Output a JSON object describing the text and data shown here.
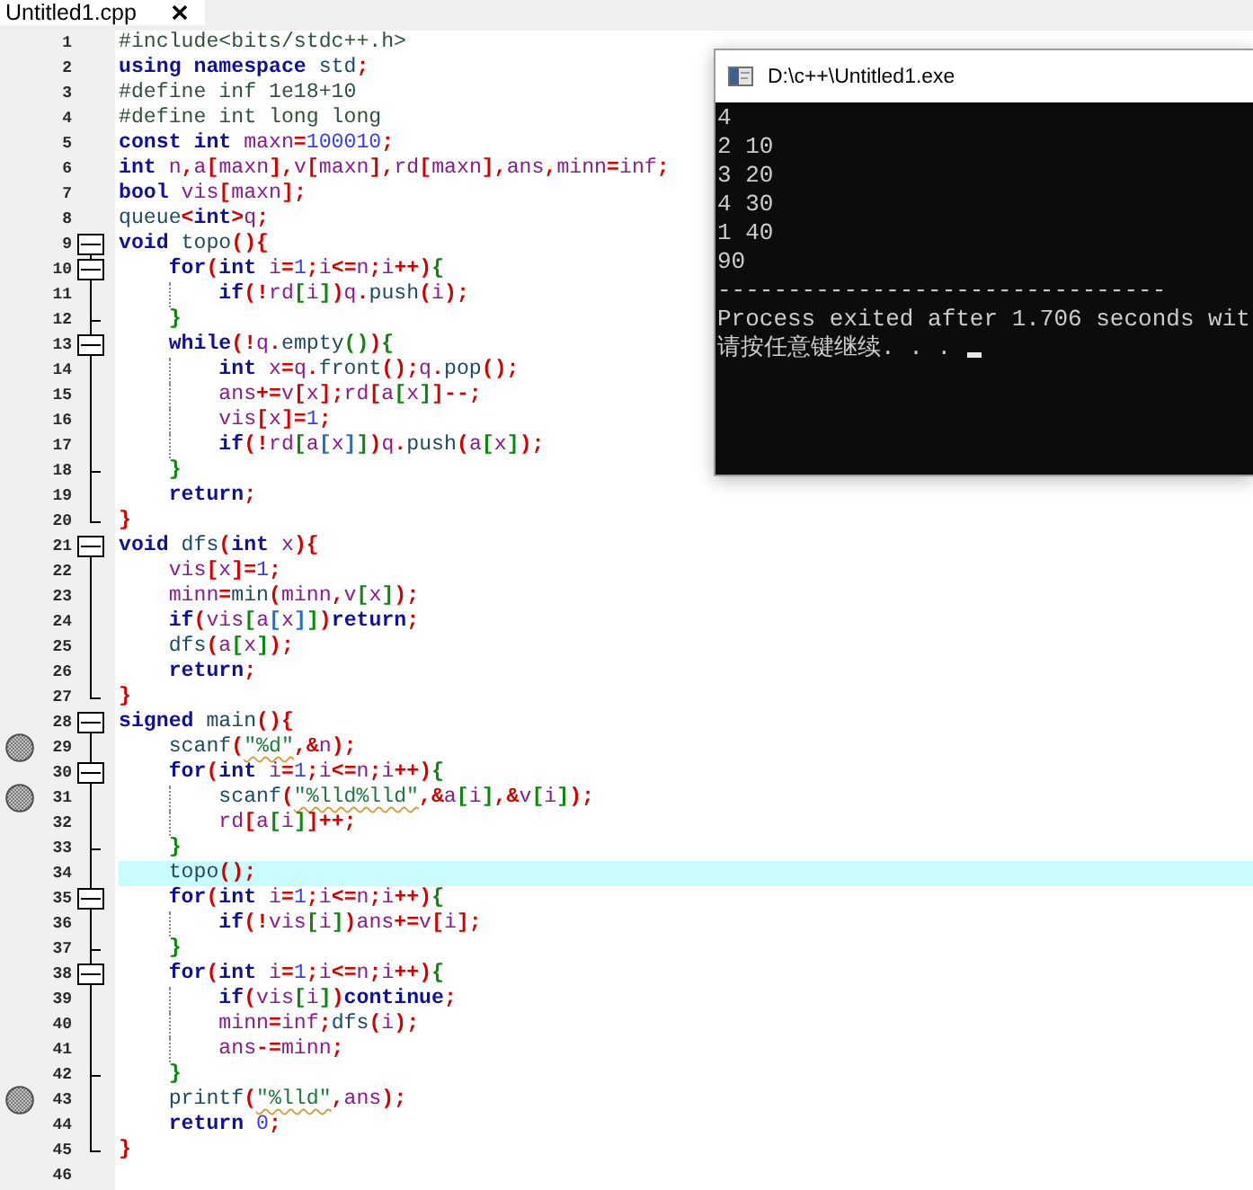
{
  "tabs": [
    {
      "label": "Untitled1.cpp",
      "selected": true
    }
  ],
  "lines": [
    {
      "number": "1",
      "breakpoint": false,
      "highlighted": false,
      "code": [
        {
          "text": "#include<bits/stdc++.h>",
          "kind": "directive"
        }
      ]
    },
    {
      "number": "2",
      "breakpoint": false,
      "highlighted": false,
      "code": [
        {
          "text": "using namespace ",
          "kind": "keyword"
        },
        {
          "text": "std",
          "kind": "function"
        },
        {
          "text": ";",
          "kind": "symbol"
        }
      ]
    },
    {
      "number": "3",
      "breakpoint": false,
      "highlighted": false,
      "code": [
        {
          "text": "#define inf 1e18+10",
          "kind": "directive"
        }
      ]
    },
    {
      "number": "4",
      "breakpoint": false,
      "highlighted": false,
      "code": [
        {
          "text": "#define int long long",
          "kind": "directive"
        }
      ]
    },
    {
      "number": "5",
      "breakpoint": false,
      "highlighted": false,
      "code": [
        {
          "text": "const int ",
          "kind": "keyword"
        },
        {
          "text": "maxn",
          "kind": "variable"
        },
        {
          "text": "=",
          "kind": "symbol"
        },
        {
          "text": "100010",
          "kind": "number"
        },
        {
          "text": ";",
          "kind": "symbol"
        }
      ]
    },
    {
      "number": "6",
      "breakpoint": false,
      "highlighted": false,
      "code": [
        {
          "text": "int ",
          "kind": "keyword"
        },
        {
          "text": "n",
          "kind": "variable"
        },
        {
          "text": ",",
          "kind": "symbol"
        },
        {
          "text": "a",
          "kind": "variable"
        },
        {
          "text": "[",
          "kind": "symbol"
        },
        {
          "text": "maxn",
          "kind": "variable"
        },
        {
          "text": "],",
          "kind": "symbol"
        },
        {
          "text": "v",
          "kind": "variable"
        },
        {
          "text": "[",
          "kind": "symbol"
        },
        {
          "text": "maxn",
          "kind": "variable"
        },
        {
          "text": "],",
          "kind": "symbol"
        },
        {
          "text": "rd",
          "kind": "variable"
        },
        {
          "text": "[",
          "kind": "symbol"
        },
        {
          "text": "maxn",
          "kind": "variable"
        },
        {
          "text": "],",
          "kind": "symbol"
        },
        {
          "text": "ans",
          "kind": "variable"
        },
        {
          "text": ",",
          "kind": "symbol"
        },
        {
          "text": "minn",
          "kind": "variable"
        },
        {
          "text": "=",
          "kind": "symbol"
        },
        {
          "text": "inf",
          "kind": "variable"
        },
        {
          "text": ";",
          "kind": "symbol"
        }
      ]
    },
    {
      "number": "7",
      "breakpoint": false,
      "highlighted": false,
      "code": [
        {
          "text": "bool ",
          "kind": "keyword"
        },
        {
          "text": "vis",
          "kind": "variable"
        },
        {
          "text": "[",
          "kind": "symbol"
        },
        {
          "text": "maxn",
          "kind": "variable"
        },
        {
          "text": "];",
          "kind": "symbol"
        }
      ]
    },
    {
      "number": "8",
      "breakpoint": false,
      "highlighted": false,
      "code": [
        {
          "text": "queue",
          "kind": "function"
        },
        {
          "text": "<",
          "kind": "symbol"
        },
        {
          "text": "int",
          "kind": "keyword"
        },
        {
          "text": ">",
          "kind": "symbol"
        },
        {
          "text": "q",
          "kind": "variable"
        },
        {
          "text": ";",
          "kind": "symbol"
        }
      ]
    },
    {
      "number": "9",
      "breakpoint": false,
      "highlighted": false,
      "expanded": true,
      "code": [
        {
          "text": "void ",
          "kind": "keyword"
        },
        {
          "text": "topo",
          "kind": "function"
        },
        {
          "text": "(){",
          "kind": "symbol"
        }
      ],
      "children": [
        {
          "number": "10",
          "breakpoint": false,
          "highlighted": false,
          "expanded": true,
          "code": [
            {
              "text": "for",
              "kind": "keyword"
            },
            {
              "text": "(",
              "kind": "symbol"
            },
            {
              "text": "int ",
              "kind": "keyword"
            },
            {
              "text": "i",
              "kind": "variable"
            },
            {
              "text": "=",
              "kind": "symbol"
            },
            {
              "text": "1",
              "kind": "number"
            },
            {
              "text": ";",
              "kind": "symbol"
            },
            {
              "text": "i",
              "kind": "variable"
            },
            {
              "text": "<=",
              "kind": "symbol"
            },
            {
              "text": "n",
              "kind": "variable"
            },
            {
              "text": ";",
              "kind": "symbol"
            },
            {
              "text": "i",
              "kind": "variable"
            },
            {
              "text": "++)",
              "kind": "symbol"
            },
            {
              "text": "{",
              "kind": "nested"
            }
          ],
          "children": [
            {
              "number": "11",
              "breakpoint": false,
              "highlighted": false,
              "code": [
                {
                  "text": "if",
                  "kind": "keyword"
                },
                {
                  "text": "(!",
                  "kind": "symbol"
                },
                {
                  "text": "rd",
                  "kind": "variable"
                },
                {
                  "text": "[",
                  "kind": "nested"
                },
                {
                  "text": "i",
                  "kind": "variable"
                },
                {
                  "text": "]",
                  "kind": "nested"
                },
                {
                  "text": ")",
                  "kind": "symbol"
                },
                {
                  "text": "q",
                  "kind": "variable"
                },
                {
                  "text": ".",
                  "kind": "symbol"
                },
                {
                  "text": "push",
                  "kind": "function"
                },
                {
                  "text": "(",
                  "kind": "symbol"
                },
                {
                  "text": "i",
                  "kind": "variable"
                },
                {
                  "text": ");",
                  "kind": "symbol"
                }
              ]
            }
          ]
        },
        {
          "number": "12",
          "breakpoint": false,
          "highlighted": false,
          "code": [
            {
              "text": "}",
              "kind": "nested"
            }
          ]
        },
        {
          "number": "13",
          "breakpoint": false,
          "highlighted": false,
          "expanded": true,
          "code": [
            {
              "text": "while",
              "kind": "keyword"
            },
            {
              "text": "(!",
              "kind": "symbol"
            },
            {
              "text": "q",
              "kind": "variable"
            },
            {
              "text": ".",
              "kind": "symbol"
            },
            {
              "text": "empty",
              "kind": "function"
            },
            {
              "text": "()",
              "kind": "nested"
            },
            {
              "text": ")",
              "kind": "symbol"
            },
            {
              "text": "{",
              "kind": "nested"
            }
          ],
          "children": [
            {
              "number": "14",
              "breakpoint": false,
              "highlighted": false,
              "code": [
                {
                  "text": "int ",
                  "kind": "keyword"
                },
                {
                  "text": "x",
                  "kind": "variable"
                },
                {
                  "text": "=",
                  "kind": "symbol"
                },
                {
                  "text": "q",
                  "kind": "variable"
                },
                {
                  "text": ".",
                  "kind": "symbol"
                },
                {
                  "text": "front",
                  "kind": "function"
                },
                {
                  "text": "();",
                  "kind": "symbol"
                },
                {
                  "text": "q",
                  "kind": "variable"
                },
                {
                  "text": ".",
                  "kind": "symbol"
                },
                {
                  "text": "pop",
                  "kind": "function"
                },
                {
                  "text": "();",
                  "kind": "symbol"
                }
              ]
            },
            {
              "number": "15",
              "breakpoint": false,
              "highlighted": false,
              "code": [
                {
                  "text": "ans",
                  "kind": "variable"
                },
                {
                  "text": "+=",
                  "kind": "symbol"
                },
                {
                  "text": "v",
                  "kind": "variable"
                },
                {
                  "text": "[",
                  "kind": "symbol"
                },
                {
                  "text": "x",
                  "kind": "variable"
                },
                {
                  "text": "];",
                  "kind": "symbol"
                },
                {
                  "text": "rd",
                  "kind": "variable"
                },
                {
                  "text": "[",
                  "kind": "symbol"
                },
                {
                  "text": "a",
                  "kind": "variable"
                },
                {
                  "text": "[",
                  "kind": "nested"
                },
                {
                  "text": "x",
                  "kind": "variable"
                },
                {
                  "text": "]",
                  "kind": "nested"
                },
                {
                  "text": "]--;",
                  "kind": "symbol"
                }
              ]
            },
            {
              "number": "16",
              "breakpoint": false,
              "highlighted": false,
              "code": [
                {
                  "text": "vis",
                  "kind": "variable"
                },
                {
                  "text": "[",
                  "kind": "symbol"
                },
                {
                  "text": "x",
                  "kind": "variable"
                },
                {
                  "text": "]=",
                  "kind": "symbol"
                },
                {
                  "text": "1",
                  "kind": "number"
                },
                {
                  "text": ";",
                  "kind": "symbol"
                }
              ]
            },
            {
              "number": "17",
              "breakpoint": false,
              "highlighted": false,
              "code": [
                {
                  "text": "if",
                  "kind": "keyword"
                },
                {
                  "text": "(!",
                  "kind": "symbol"
                },
                {
                  "text": "rd",
                  "kind": "variable"
                },
                {
                  "text": "[",
                  "kind": "nested"
                },
                {
                  "text": "a",
                  "kind": "variable"
                },
                {
                  "text": "[",
                  "kind": "deeper"
                },
                {
                  "text": "x",
                  "kind": "variable"
                },
                {
                  "text": "]",
                  "kind": "deeper"
                },
                {
                  "text": "]",
                  "kind": "nested"
                },
                {
                  "text": ")",
                  "kind": "symbol"
                },
                {
                  "text": "q",
                  "kind": "variable"
                },
                {
                  "text": ".",
                  "kind": "symbol"
                },
                {
                  "text": "push",
                  "kind": "function"
                },
                {
                  "text": "(",
                  "kind": "symbol"
                },
                {
                  "text": "a",
                  "kind": "variable"
                },
                {
                  "text": "[",
                  "kind": "nested"
                },
                {
                  "text": "x",
                  "kind": "variable"
                },
                {
                  "text": "]",
                  "kind": "nested"
                },
                {
                  "text": ");",
                  "kind": "symbol"
                }
              ]
            }
          ]
        },
        {
          "number": "18",
          "breakpoint": false,
          "highlighted": false,
          "code": [
            {
              "text": "}",
              "kind": "nested"
            }
          ]
        },
        {
          "number": "19",
          "breakpoint": false,
          "highlighted": false,
          "code": [
            {
              "text": "return",
              "kind": "keyword"
            },
            {
              "text": ";",
              "kind": "symbol"
            }
          ]
        }
      ]
    },
    {
      "number": "20",
      "breakpoint": false,
      "highlighted": false,
      "code": [
        {
          "text": "}",
          "kind": "symbol"
        }
      ]
    },
    {
      "number": "21",
      "breakpoint": false,
      "highlighted": false,
      "expanded": true,
      "code": [
        {
          "text": "void ",
          "kind": "keyword"
        },
        {
          "text": "dfs",
          "kind": "function"
        },
        {
          "text": "(",
          "kind": "symbol"
        },
        {
          "text": "int ",
          "kind": "keyword"
        },
        {
          "text": "x",
          "kind": "variable"
        },
        {
          "text": "){",
          "kind": "symbol"
        }
      ],
      "children": [
        {
          "number": "22",
          "breakpoint": false,
          "highlighted": false,
          "code": [
            {
              "text": "vis",
              "kind": "variable"
            },
            {
              "text": "[",
              "kind": "symbol"
            },
            {
              "text": "x",
              "kind": "variable"
            },
            {
              "text": "]=",
              "kind": "symbol"
            },
            {
              "text": "1",
              "kind": "number"
            },
            {
              "text": ";",
              "kind": "symbol"
            }
          ]
        },
        {
          "number": "23",
          "breakpoint": false,
          "highlighted": false,
          "code": [
            {
              "text": "minn",
              "kind": "variable"
            },
            {
              "text": "=",
              "kind": "symbol"
            },
            {
              "text": "min",
              "kind": "function"
            },
            {
              "text": "(",
              "kind": "symbol"
            },
            {
              "text": "minn",
              "kind": "variable"
            },
            {
              "text": ",",
              "kind": "symbol"
            },
            {
              "text": "v",
              "kind": "variable"
            },
            {
              "text": "[",
              "kind": "nested"
            },
            {
              "text": "x",
              "kind": "variable"
            },
            {
              "text": "]",
              "kind": "nested"
            },
            {
              "text": ");",
              "kind": "symbol"
            }
          ]
        },
        {
          "number": "24",
          "breakpoint": false,
          "highlighted": false,
          "code": [
            {
              "text": "if",
              "kind": "keyword"
            },
            {
              "text": "(",
              "kind": "symbol"
            },
            {
              "text": "vis",
              "kind": "variable"
            },
            {
              "text": "[",
              "kind": "nested"
            },
            {
              "text": "a",
              "kind": "variable"
            },
            {
              "text": "[",
              "kind": "deeper"
            },
            {
              "text": "x",
              "kind": "variable"
            },
            {
              "text": "]",
              "kind": "deeper"
            },
            {
              "text": "]",
              "kind": "nested"
            },
            {
              "text": ")",
              "kind": "symbol"
            },
            {
              "text": "return",
              "kind": "keyword"
            },
            {
              "text": ";",
              "kind": "symbol"
            }
          ]
        },
        {
          "number": "25",
          "breakpoint": false,
          "highlighted": false,
          "code": [
            {
              "text": "dfs",
              "kind": "function"
            },
            {
              "text": "(",
              "kind": "symbol"
            },
            {
              "text": "a",
              "kind": "variable"
            },
            {
              "text": "[",
              "kind": "nested"
            },
            {
              "text": "x",
              "kind": "variable"
            },
            {
              "text": "]",
              "kind": "nested"
            },
            {
              "text": ");",
              "kind": "symbol"
            }
          ]
        },
        {
          "number": "26",
          "breakpoint": false,
          "highlighted": false,
          "code": [
            {
              "text": "return",
              "kind": "keyword"
            },
            {
              "text": ";",
              "kind": "symbol"
            }
          ]
        }
      ]
    },
    {
      "number": "27",
      "breakpoint": false,
      "highlighted": false,
      "code": [
        {
          "text": "}",
          "kind": "symbol"
        }
      ]
    },
    {
      "number": "28",
      "breakpoint": false,
      "highlighted": false,
      "expanded": true,
      "code": [
        {
          "text": "signed ",
          "kind": "keyword"
        },
        {
          "text": "main",
          "kind": "function"
        },
        {
          "text": "(){",
          "kind": "symbol"
        }
      ],
      "children": [
        {
          "number": "29",
          "breakpoint": true,
          "highlighted": false,
          "code": [
            {
              "text": "scanf",
              "kind": "function"
            },
            {
              "text": "(",
              "kind": "symbol"
            },
            {
              "text": "\"%d\"",
              "kind": "string"
            },
            {
              "text": ",&",
              "kind": "symbol"
            },
            {
              "text": "n",
              "kind": "variable"
            },
            {
              "text": ");",
              "kind": "symbol"
            }
          ]
        },
        {
          "number": "30",
          "breakpoint": false,
          "highlighted": false,
          "expanded": true,
          "code": [
            {
              "text": "for",
              "kind": "keyword"
            },
            {
              "text": "(",
              "kind": "symbol"
            },
            {
              "text": "int ",
              "kind": "keyword"
            },
            {
              "text": "i",
              "kind": "variable"
            },
            {
              "text": "=",
              "kind": "symbol"
            },
            {
              "text": "1",
              "kind": "number"
            },
            {
              "text": ";",
              "kind": "symbol"
            },
            {
              "text": "i",
              "kind": "variable"
            },
            {
              "text": "<=",
              "kind": "symbol"
            },
            {
              "text": "n",
              "kind": "variable"
            },
            {
              "text": ";",
              "kind": "symbol"
            },
            {
              "text": "i",
              "kind": "variable"
            },
            {
              "text": "++)",
              "kind": "symbol"
            },
            {
              "text": "{",
              "kind": "nested"
            }
          ],
          "children": [
            {
              "number": "31",
              "breakpoint": true,
              "highlighted": false,
              "code": [
                {
                  "text": "scanf",
                  "kind": "function"
                },
                {
                  "text": "(",
                  "kind": "symbol"
                },
                {
                  "text": "\"%lld%lld\"",
                  "kind": "string"
                },
                {
                  "text": ",&",
                  "kind": "symbol"
                },
                {
                  "text": "a",
                  "kind": "variable"
                },
                {
                  "text": "[",
                  "kind": "nested"
                },
                {
                  "text": "i",
                  "kind": "variable"
                },
                {
                  "text": "]",
                  "kind": "nested"
                },
                {
                  "text": ",&",
                  "kind": "symbol"
                },
                {
                  "text": "v",
                  "kind": "variable"
                },
                {
                  "text": "[",
                  "kind": "nested"
                },
                {
                  "text": "i",
                  "kind": "variable"
                },
                {
                  "text": "]",
                  "kind": "nested"
                },
                {
                  "text": ");",
                  "kind": "symbol"
                }
              ]
            },
            {
              "number": "32",
              "breakpoint": false,
              "highlighted": false,
              "code": [
                {
                  "text": "rd",
                  "kind": "variable"
                },
                {
                  "text": "[",
                  "kind": "symbol"
                },
                {
                  "text": "a",
                  "kind": "variable"
                },
                {
                  "text": "[",
                  "kind": "nested"
                },
                {
                  "text": "i",
                  "kind": "variable"
                },
                {
                  "text": "]",
                  "kind": "nested"
                },
                {
                  "text": "]++;",
                  "kind": "symbol"
                }
              ]
            }
          ]
        },
        {
          "number": "33",
          "breakpoint": false,
          "highlighted": false,
          "code": [
            {
              "text": "}",
              "kind": "nested"
            }
          ]
        },
        {
          "number": "34",
          "breakpoint": false,
          "highlighted": true,
          "code": [
            {
              "text": "topo",
              "kind": "function"
            },
            {
              "text": "();",
              "kind": "symbol"
            }
          ]
        },
        {
          "number": "35",
          "breakpoint": false,
          "highlighted": false,
          "expanded": true,
          "code": [
            {
              "text": "for",
              "kind": "keyword"
            },
            {
              "text": "(",
              "kind": "symbol"
            },
            {
              "text": "int ",
              "kind": "keyword"
            },
            {
              "text": "i",
              "kind": "variable"
            },
            {
              "text": "=",
              "kind": "symbol"
            },
            {
              "text": "1",
              "kind": "number"
            },
            {
              "text": ";",
              "kind": "symbol"
            },
            {
              "text": "i",
              "kind": "variable"
            },
            {
              "text": "<=",
              "kind": "symbol"
            },
            {
              "text": "n",
              "kind": "variable"
            },
            {
              "text": ";",
              "kind": "symbol"
            },
            {
              "text": "i",
              "kind": "variable"
            },
            {
              "text": "++)",
              "kind": "symbol"
            },
            {
              "text": "{",
              "kind": "nested"
            }
          ],
          "children": [
            {
              "number": "36",
              "breakpoint": false,
              "highlighted": false,
              "code": [
                {
                  "text": "if",
                  "kind": "keyword"
                },
                {
                  "text": "(!",
                  "kind": "symbol"
                },
                {
                  "text": "vis",
                  "kind": "variable"
                },
                {
                  "text": "[",
                  "kind": "nested"
                },
                {
                  "text": "i",
                  "kind": "variable"
                },
                {
                  "text": "]",
                  "kind": "nested"
                },
                {
                  "text": ")",
                  "kind": "symbol"
                },
                {
                  "text": "ans",
                  "kind": "variable"
                },
                {
                  "text": "+=",
                  "kind": "symbol"
                },
                {
                  "text": "v",
                  "kind": "variable"
                },
                {
                  "text": "[",
                  "kind": "symbol"
                },
                {
                  "text": "i",
                  "kind": "variable"
                },
                {
                  "text": "];",
                  "kind": "symbol"
                }
              ]
            }
          ]
        },
        {
          "number": "37",
          "breakpoint": false,
          "highlighted": false,
          "code": [
            {
              "text": "}",
              "kind": "nested"
            }
          ]
        },
        {
          "number": "38",
          "breakpoint": false,
          "highlighted": false,
          "expanded": true,
          "code": [
            {
              "text": "for",
              "kind": "keyword"
            },
            {
              "text": "(",
              "kind": "symbol"
            },
            {
              "text": "int ",
              "kind": "keyword"
            },
            {
              "text": "i",
              "kind": "variable"
            },
            {
              "text": "=",
              "kind": "symbol"
            },
            {
              "text": "1",
              "kind": "number"
            },
            {
              "text": ";",
              "kind": "symbol"
            },
            {
              "text": "i",
              "kind": "variable"
            },
            {
              "text": "<=",
              "kind": "symbol"
            },
            {
              "text": "n",
              "kind": "variable"
            },
            {
              "text": ";",
              "kind": "symbol"
            },
            {
              "text": "i",
              "kind": "variable"
            },
            {
              "text": "++)",
              "kind": "symbol"
            },
            {
              "text": "{",
              "kind": "nested"
            }
          ],
          "children": [
            {
              "number": "39",
              "breakpoint": false,
              "highlighted": false,
              "code": [
                {
                  "text": "if",
                  "kind": "keyword"
                },
                {
                  "text": "(",
                  "kind": "symbol"
                },
                {
                  "text": "vis",
                  "kind": "variable"
                },
                {
                  "text": "[",
                  "kind": "nested"
                },
                {
                  "text": "i",
                  "kind": "variable"
                },
                {
                  "text": "]",
                  "kind": "nested"
                },
                {
                  "text": ")",
                  "kind": "symbol"
                },
                {
                  "text": "continue",
                  "kind": "keyword"
                },
                {
                  "text": ";",
                  "kind": "symbol"
                }
              ]
            },
            {
              "number": "40",
              "breakpoint": false,
              "highlighted": false,
              "code": [
                {
                  "text": "minn",
                  "kind": "variable"
                },
                {
                  "text": "=",
                  "kind": "symbol"
                },
                {
                  "text": "inf",
                  "kind": "variable"
                },
                {
                  "text": ";",
                  "kind": "symbol"
                },
                {
                  "text": "dfs",
                  "kind": "function"
                },
                {
                  "text": "(",
                  "kind": "symbol"
                },
                {
                  "text": "i",
                  "kind": "variable"
                },
                {
                  "text": ");",
                  "kind": "symbol"
                }
              ]
            },
            {
              "number": "41",
              "breakpoint": false,
              "highlighted": false,
              "code": [
                {
                  "text": "ans",
                  "kind": "variable"
                },
                {
                  "text": "-=",
                  "kind": "symbol"
                },
                {
                  "text": "minn",
                  "kind": "variable"
                },
                {
                  "text": ";",
                  "kind": "symbol"
                }
              ]
            }
          ]
        },
        {
          "number": "42",
          "breakpoint": false,
          "highlighted": false,
          "code": [
            {
              "text": "}",
              "kind": "nested"
            }
          ]
        },
        {
          "number": "43",
          "breakpoint": true,
          "highlighted": false,
          "code": [
            {
              "text": "printf",
              "kind": "function"
            },
            {
              "text": "(",
              "kind": "symbol"
            },
            {
              "text": "\"%lld\"",
              "kind": "string"
            },
            {
              "text": ",",
              "kind": "symbol"
            },
            {
              "text": "ans",
              "kind": "variable"
            },
            {
              "text": ");",
              "kind": "symbol"
            }
          ]
        },
        {
          "number": "44",
          "breakpoint": false,
          "highlighted": false,
          "code": [
            {
              "text": "return ",
              "kind": "keyword"
            },
            {
              "text": "0",
              "kind": "number"
            },
            {
              "text": ";",
              "kind": "symbol"
            }
          ]
        }
      ]
    },
    {
      "number": "45",
      "breakpoint": false,
      "highlighted": false,
      "code": [
        {
          "text": "}",
          "kind": "symbol"
        }
      ]
    },
    {
      "number": "46",
      "breakpoint": false,
      "highlighted": false
    }
  ],
  "console": {
    "title": "D:\\c++\\Untitled1.exe",
    "output": [
      "4",
      "2 10",
      "3 20",
      "4 30",
      "1 40",
      "90",
      "--------------------------------",
      "Process exited after 1.706 seconds wit",
      "请按任意键继续. . ."
    ],
    "cursor_shown": true
  }
}
